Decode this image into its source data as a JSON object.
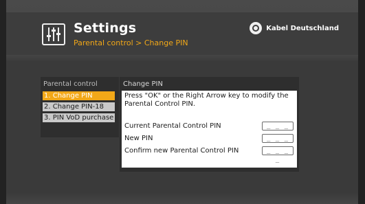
{
  "header": {
    "title": "Settings",
    "breadcrumb": "Parental control > Change PIN",
    "settings_icon": "equalizer-sliders-icon",
    "brand": {
      "name": "Kabel Deutschland",
      "logo_icon": "kabel-deutschland-logo-icon"
    }
  },
  "menu": {
    "title": "Parental control",
    "items": [
      {
        "label": "1. Change PIN",
        "selected": true
      },
      {
        "label": "2. Change PIN-18",
        "selected": false
      },
      {
        "label": "3. PIN VoD purchase",
        "selected": false
      }
    ]
  },
  "content": {
    "title": "Change PIN",
    "instructions": "Press \"OK\" or the Right Arrow key to modify the Parental Control PIN.",
    "fields": [
      {
        "label": "Current Parental Control PIN",
        "value": "_ _ _ _"
      },
      {
        "label": "New PIN",
        "value": "_ _ _ _"
      },
      {
        "label": "Confirm new Parental Control PIN",
        "value": "_ _ _ _"
      }
    ]
  },
  "colors": {
    "accent": "#f2a818",
    "background": "#3a3a3a",
    "panel": "#2e2e2e",
    "menu_item": "#c9c9c9"
  }
}
